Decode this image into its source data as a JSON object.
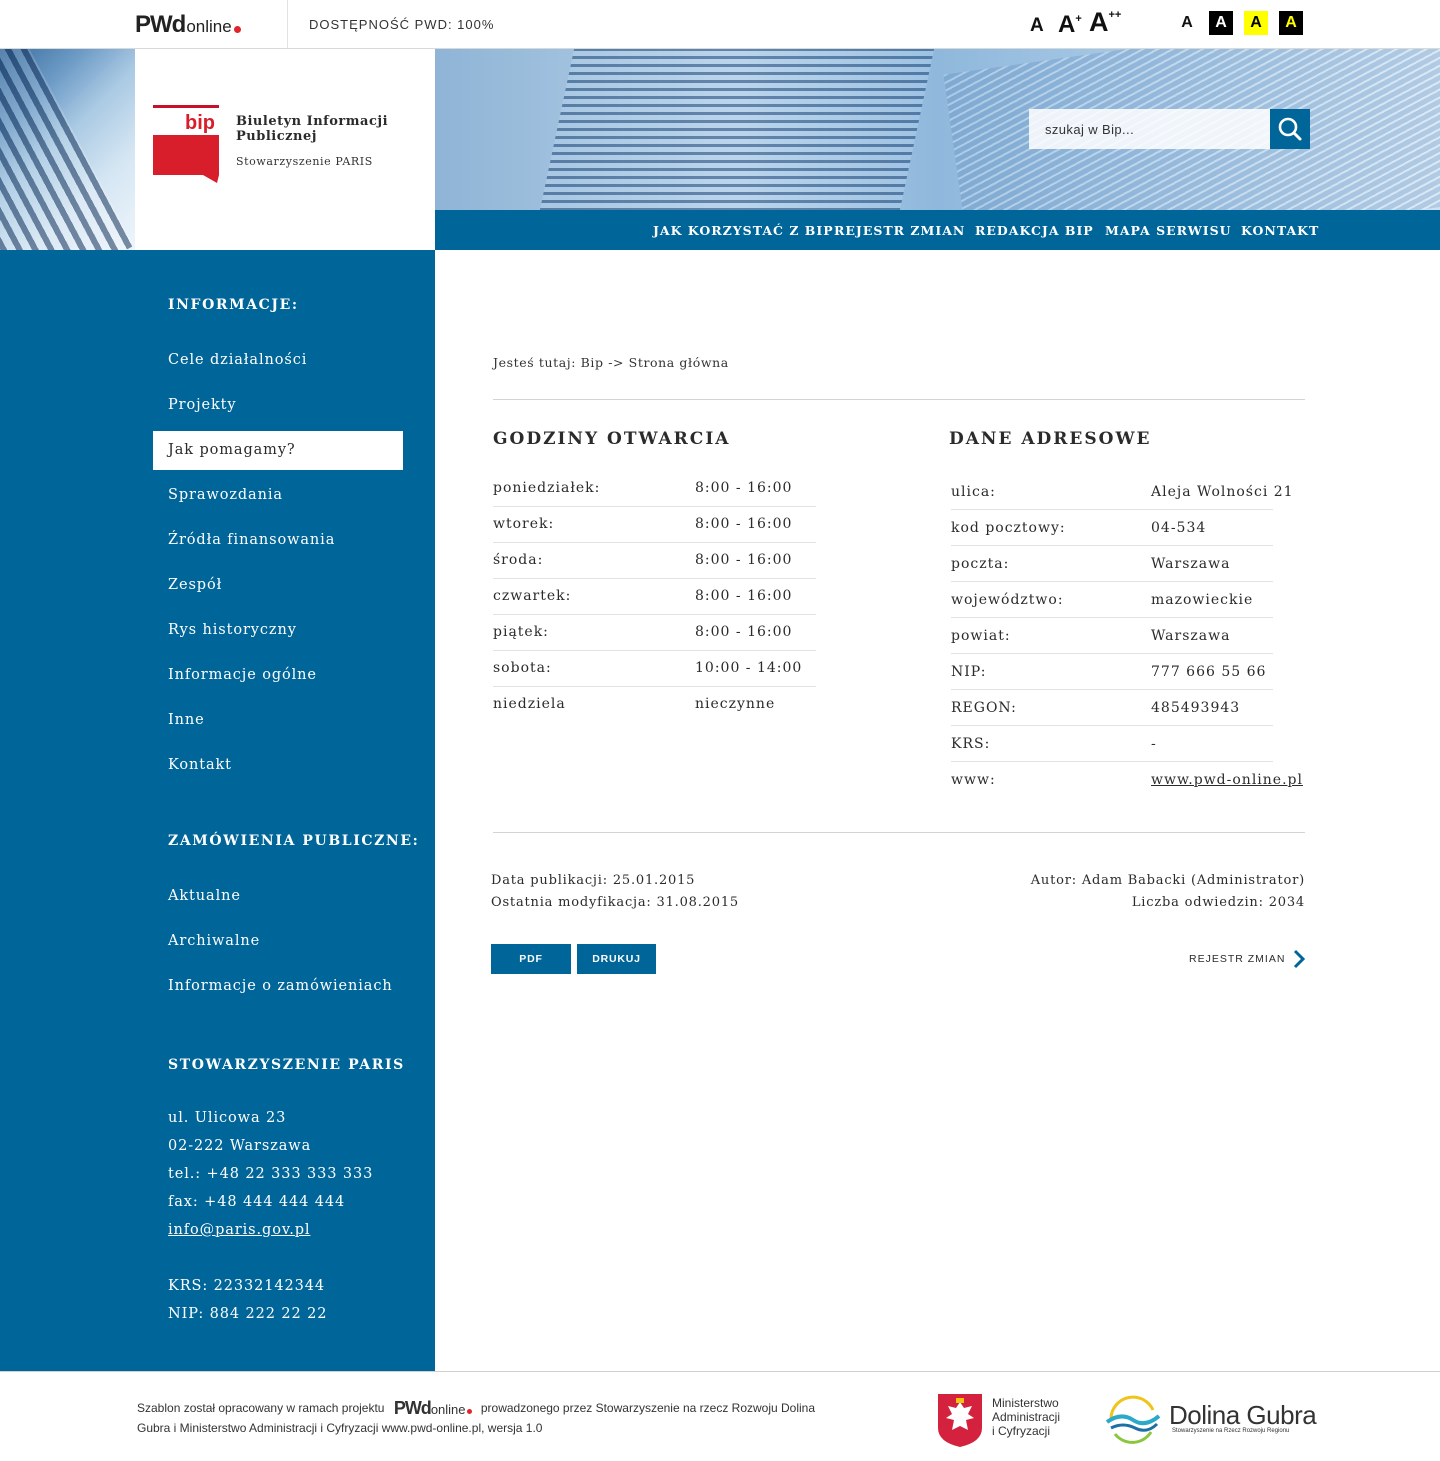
{
  "topbar": {
    "logo_main": "PWd",
    "logo_online": "online",
    "accessibility_label": "DOSTĘPNOŚĆ PWD: 100%",
    "font_sizes": [
      "A",
      "A",
      "A"
    ],
    "font_size_sup": [
      "",
      "+",
      "++"
    ],
    "contrast_options": [
      "A",
      "A",
      "A",
      "A"
    ]
  },
  "brand": {
    "bip_mark": "bip",
    "title": "Biuletyn Informacji Publicznej",
    "subtitle": "Stowarzyszenie PARIS"
  },
  "search": {
    "placeholder": "szukaj w Bip..."
  },
  "nav": {
    "items": [
      "JAK KORZYSTAĆ Z BIP",
      "REJESTR ZMIAN",
      "REDAKCJA BIP",
      "MAPA SERWISU",
      "KONTAKT"
    ]
  },
  "sidebar": {
    "info_heading": "INFORMACJE:",
    "info_items": [
      "Cele działalności",
      "Projekty",
      "Jak pomagamy?",
      "Sprawozdania",
      "Źródła finansowania",
      "Zespół",
      "Rys historyczny",
      "Informacje ogólne",
      "Inne",
      "Kontakt"
    ],
    "active_item": "Jak pomagamy?",
    "orders_heading": "ZAMÓWIENIA PUBLICZNE:",
    "orders_items": [
      "Aktualne",
      "Archiwalne",
      "Informacje o zamówieniach"
    ],
    "org_heading": "STOWARZYSZENIE PARIS",
    "org_lines": [
      "ul. Ulicowa 23",
      "02-222 Warszawa",
      "tel.: +48 22 333 333 333",
      "fax: +48 444 444 444"
    ],
    "org_email": "info@paris.gov.pl",
    "org_ids": [
      "KRS: 22332142344",
      "NIP: 884 222 22 22"
    ]
  },
  "main": {
    "breadcrumb": "Jesteś tutaj: Bip -> Strona główna",
    "hours_heading": "GODZINY OTWARCIA",
    "hours": [
      {
        "day": "poniedziałek:",
        "time": "8:00 - 16:00"
      },
      {
        "day": "wtorek:",
        "time": "8:00 - 16:00"
      },
      {
        "day": "środa:",
        "time": "8:00 - 16:00"
      },
      {
        "day": "czwartek:",
        "time": "8:00 - 16:00"
      },
      {
        "day": "piątek:",
        "time": "8:00 - 16:00"
      },
      {
        "day": "sobota:",
        "time": "10:00 - 14:00"
      },
      {
        "day": "niedziela",
        "time": "nieczynne"
      }
    ],
    "address_heading": "DANE ADRESOWE",
    "address": [
      {
        "label": "ulica:",
        "value": "Aleja Wolności 21"
      },
      {
        "label": "kod pocztowy:",
        "value": "04-534"
      },
      {
        "label": "poczta:",
        "value": "Warszawa"
      },
      {
        "label": "województwo:",
        "value": "mazowieckie"
      },
      {
        "label": "powiat:",
        "value": "Warszawa"
      },
      {
        "label": "NIP:",
        "value": "777 666 55 66"
      },
      {
        "label": "REGON:",
        "value": "485493943"
      },
      {
        "label": "KRS:",
        "value": "-"
      },
      {
        "label": "www:",
        "value": "www.pwd-online.pl"
      }
    ],
    "publish_date": "Data publikacji: 25.01.2015",
    "modified_date": "Ostatnia modyfikacja: 31.08.2015",
    "author": "Autor: Adam Babacki (Administrator)",
    "visits": "Liczba odwiedzin: 2034",
    "pdf_label": "PDF",
    "print_label": "DRUKUJ",
    "changes_link": "REJESTR ZMIAN"
  },
  "footer": {
    "text_before": "Szablon został opracowany w ramach projektu",
    "text_after": "prowadzonego przez Stowarzyszenie na rzecz Rozwoju Dolina Gubra i Ministerstwo Administracji i Cyfryzacji www.pwd-online.pl, wersja 1.0",
    "logo_main": "PWd",
    "logo_online": "online",
    "ministry_lines": [
      "Ministerstwo",
      "Administracji",
      "i Cyfryzacji"
    ],
    "dg_name": "Dolina Gubra",
    "dg_sub": "Stowarzyszenie na Rzecz Rozwoju Regionu"
  },
  "colors": {
    "primary": "#006598",
    "accent_red": "#e0262b",
    "text": "#2b2b2b"
  },
  "icons": [
    "search-icon",
    "chevron-right-icon",
    "bip-logo",
    "polish-eagle-emblem",
    "dolina-gubra-logo"
  ]
}
